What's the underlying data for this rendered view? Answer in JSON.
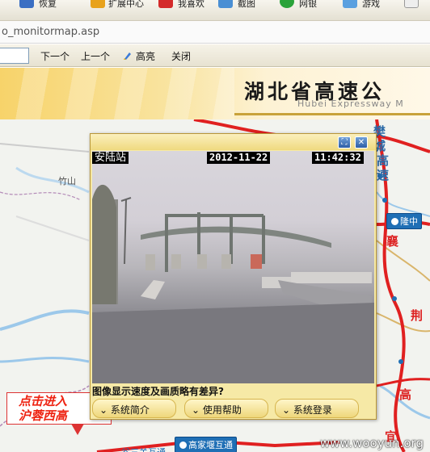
{
  "browser": {
    "toolbar": [
      "恢复",
      "扩展中心",
      "我喜欢",
      "截图",
      "网银",
      "游戏"
    ],
    "address": "o_monitormap.asp",
    "find_bar": {
      "search_value": "",
      "next_label": "下一个",
      "prev_label": "上一个",
      "highlight_label": "高亮",
      "close_label": "关闭"
    }
  },
  "header": {
    "title": "湖北省高速公",
    "subtitle": "Hubei Expressway M"
  },
  "popup": {
    "station": "安陆站",
    "date": "2012-11-22",
    "time": "11:42:32",
    "notice": "图像显示速度及画质略有差异?",
    "menu": [
      "系统简介",
      "使用帮助",
      "系统登录"
    ]
  },
  "map": {
    "place_labels": [
      "竹山",
      "隆中",
      "荆",
      "高",
      "襄",
      "宜",
      "樊",
      "城",
      "高",
      "速"
    ],
    "pins": [
      "隆中",
      "高家堰互通"
    ],
    "callout": [
      "点击进入",
      "沪蓉西高"
    ],
    "bottom_label": "谷三关互通"
  },
  "watermark": "www.wooyun.org",
  "colors": {
    "highway": "#e02020",
    "popup_bg": "#f6e9a6",
    "pin": "#1f6fb5"
  }
}
